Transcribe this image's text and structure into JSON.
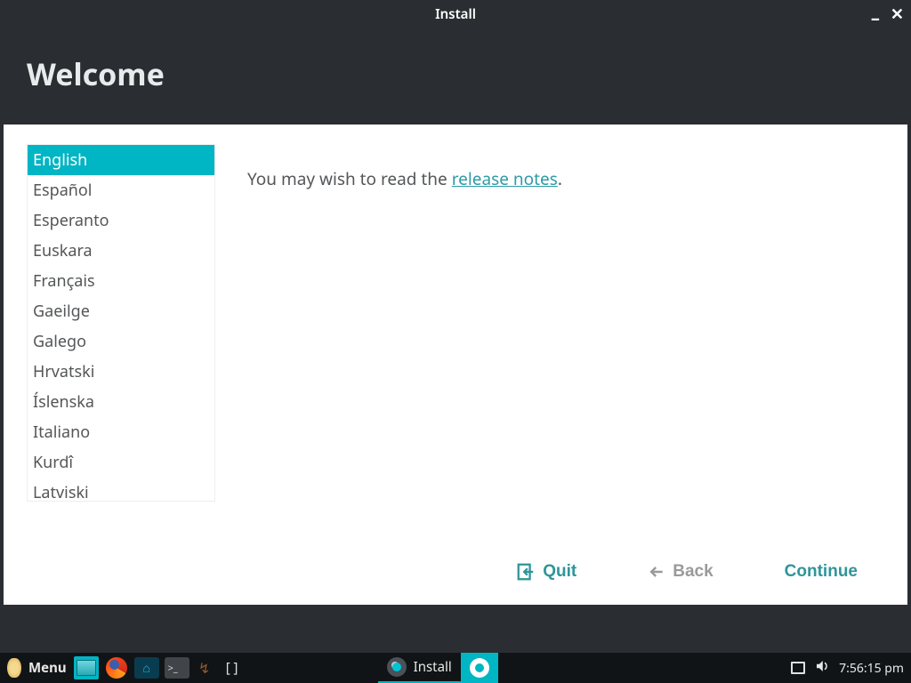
{
  "window": {
    "title": "Install",
    "heading": "Welcome"
  },
  "languages": [
    "English",
    "Español",
    "Esperanto",
    "Euskara",
    "Français",
    "Gaeilge",
    "Galego",
    "Hrvatski",
    "Íslenska",
    "Italiano",
    "Kurdî",
    "Latviski"
  ],
  "selected_language_index": 0,
  "info": {
    "prefix": "You may wish to read the ",
    "link": "release notes",
    "suffix": "."
  },
  "buttons": {
    "quit": "Quit",
    "back": "Back",
    "continue": "Continue"
  },
  "taskbar": {
    "menu_label": "Menu",
    "task_label": "Install",
    "clock": "7:56:15 pm"
  }
}
